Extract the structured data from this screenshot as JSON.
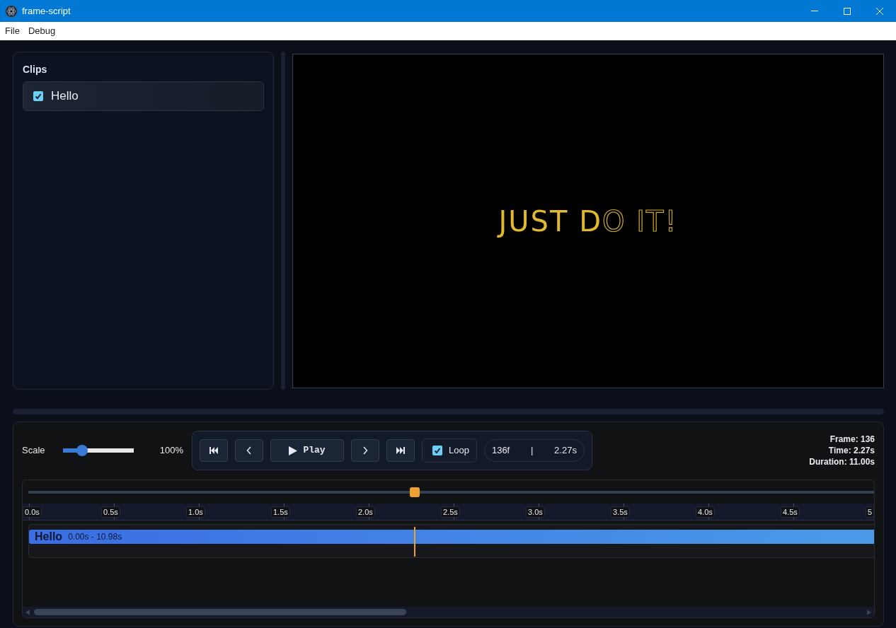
{
  "window": {
    "title": "frame-script"
  },
  "menu": [
    {
      "label": "File"
    },
    {
      "label": "Debug"
    }
  ],
  "clips_panel": {
    "title": "Clips",
    "clips": [
      {
        "label": "Hello",
        "checked": true
      }
    ]
  },
  "preview": {
    "segments": [
      {
        "text": "JUST D",
        "kind": "filled"
      },
      {
        "text": "O IT!",
        "kind": "outline"
      }
    ]
  },
  "controls": {
    "scale": {
      "label": "Scale",
      "level": 0.27,
      "reading": "100%"
    },
    "buttons": [
      {
        "kind": "first"
      },
      {
        "kind": "prev"
      },
      {
        "kind": "play",
        "label": "Play"
      },
      {
        "kind": "next"
      },
      {
        "kind": "last"
      }
    ],
    "loop": {
      "label": "Loop",
      "checked": true
    },
    "frame_readout": "136f",
    "separator": "|",
    "time_readout": "2.27s"
  },
  "stats": [
    "Frame: 136",
    "Time: 2.27s",
    "Duration: 11.00s"
  ],
  "timeline": {
    "scrub": {
      "level": 0.457
    },
    "ruler": [
      "0.0s",
      "0.5s",
      "1.0s",
      "1.5s",
      "2.0s",
      "2.5s",
      "3.0s",
      "3.5s",
      "4.0s",
      "4.5s",
      "5"
    ],
    "tracks": [
      {
        "name": "Hello",
        "range": "0.00s - 10.98s"
      }
    ]
  }
}
